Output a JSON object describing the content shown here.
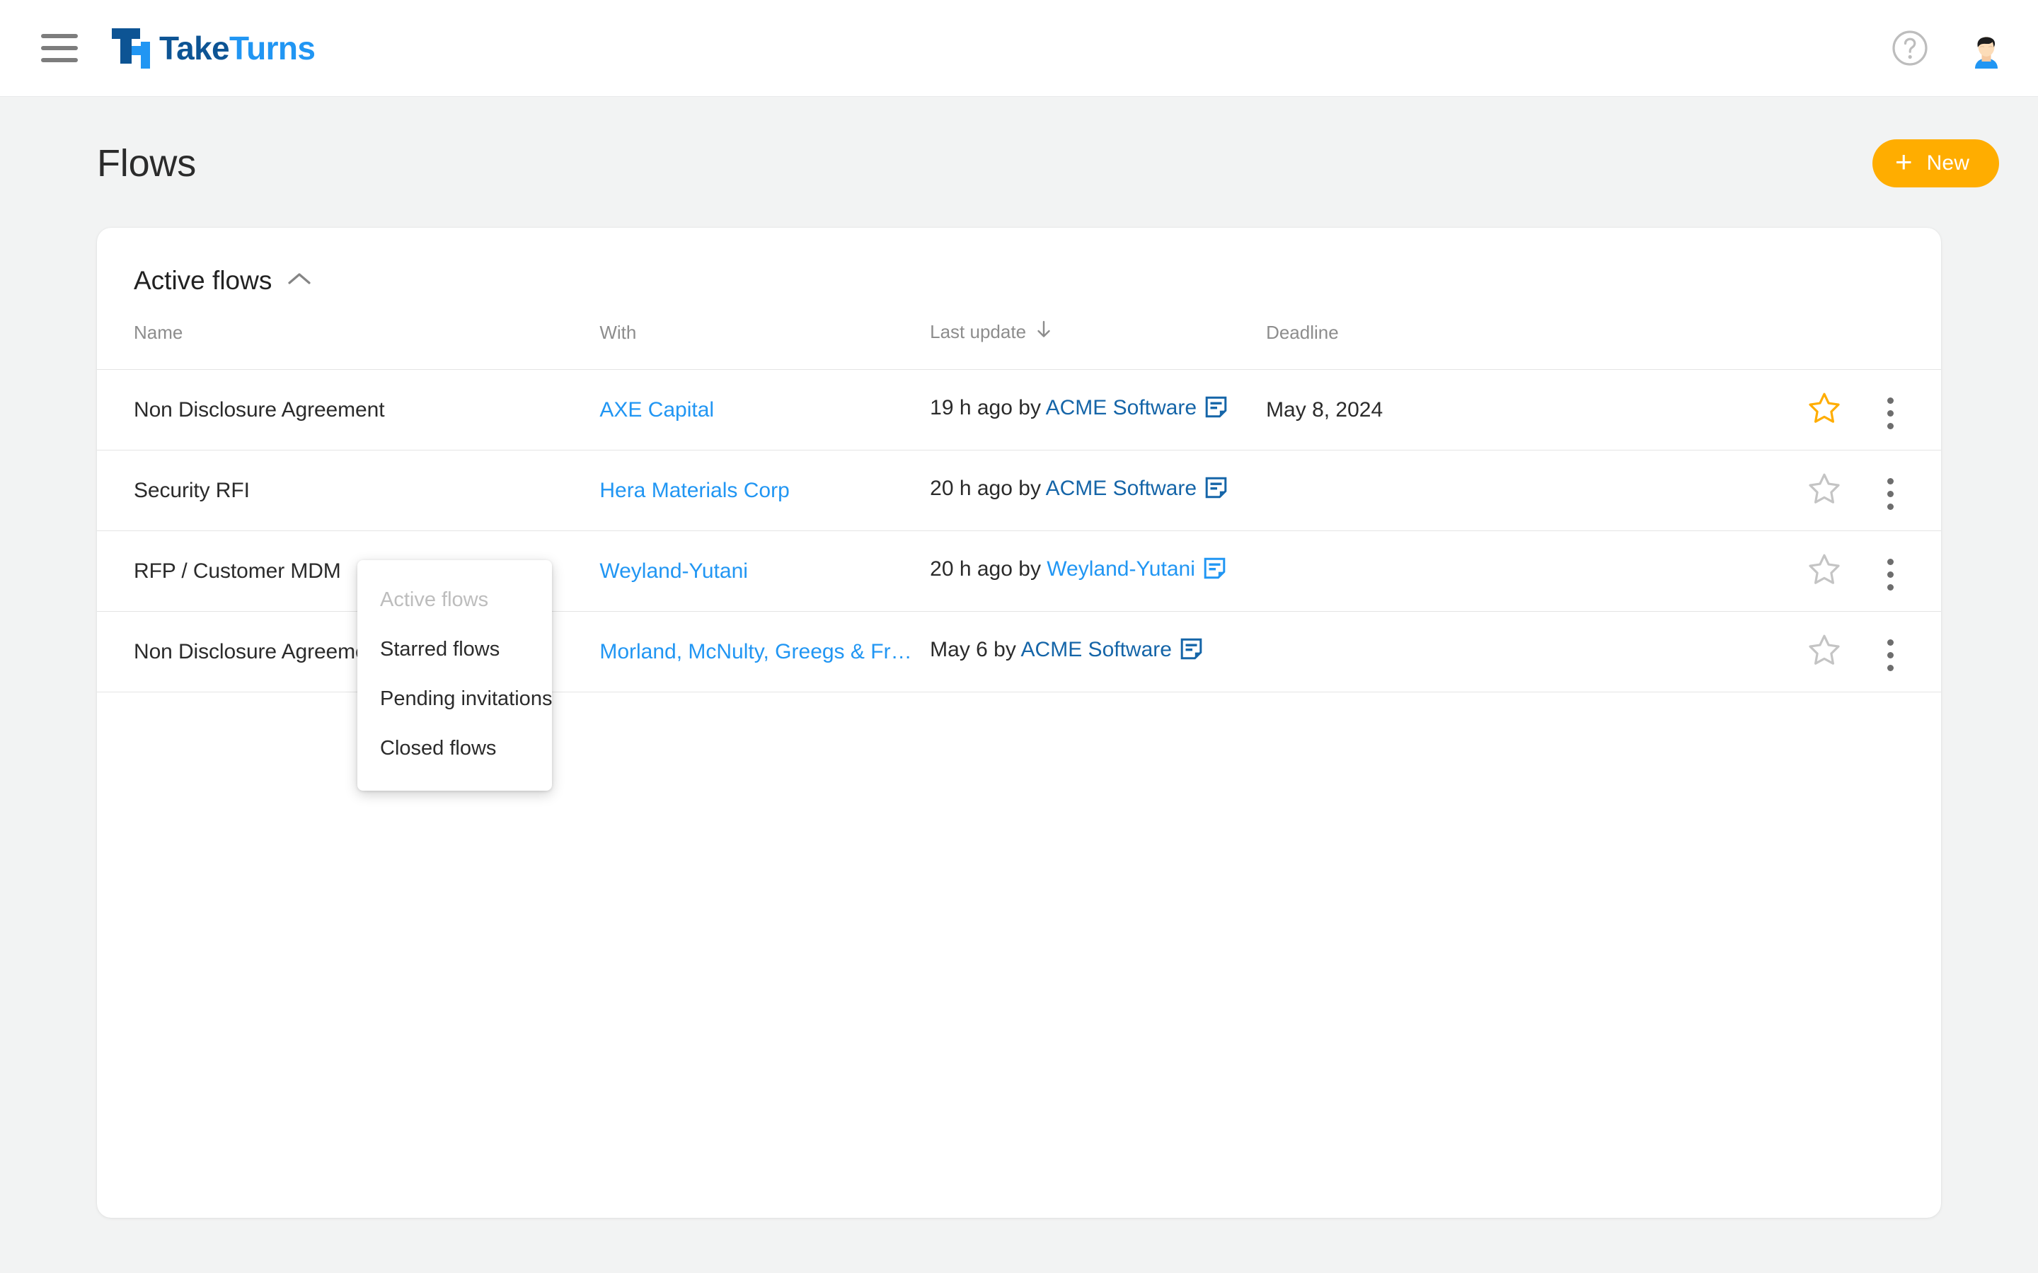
{
  "app": {
    "brand_take": "Take",
    "brand_turns": "Turns",
    "logo_icon": "taketurns-logo-icon",
    "menu_icon": "hamburger-menu-icon",
    "help_icon": "help-circle-icon",
    "avatar_icon": "user-avatar"
  },
  "colors": {
    "brand_dark_blue": "#0d5494",
    "brand_blue": "#2196f3",
    "accent_orange": "#ffad00",
    "star_gold": "#ffad00",
    "muted_text": "#8d8d8d",
    "page_bg": "#f2f3f3",
    "card_bg": "#ffffff",
    "author_dark": "#1565a8"
  },
  "page": {
    "title": "Flows",
    "new_button_label": "New",
    "new_button_icon": "plus-icon"
  },
  "card": {
    "section_label": "Active flows",
    "section_chevron": "chevron-up-icon"
  },
  "dropdown": {
    "open": true,
    "items": [
      {
        "label": "Active flows",
        "selected": true
      },
      {
        "label": "Starred flows",
        "selected": false
      },
      {
        "label": "Pending invitations",
        "selected": false
      },
      {
        "label": "Closed flows",
        "selected": false
      }
    ]
  },
  "table": {
    "columns": [
      {
        "key": "name",
        "label": "Name",
        "sortable": false
      },
      {
        "key": "with",
        "label": "With",
        "sortable": false
      },
      {
        "key": "last_update",
        "label": "Last update",
        "sortable": true,
        "sort_dir": "desc",
        "sort_icon": "arrow-down-icon"
      },
      {
        "key": "deadline",
        "label": "Deadline",
        "sortable": false
      }
    ],
    "rows": [
      {
        "name": "Non Disclosure Agreement",
        "with": "AXE Capital",
        "update_prefix": "19 h ago by",
        "update_author": "ACME Software",
        "author_tone": "dark",
        "doc_icon": "document-icon",
        "deadline": "May 8, 2024",
        "starred": true,
        "star_icon": "star-filled-icon",
        "menu_icon": "kebab-menu-icon"
      },
      {
        "name": "Security RFI",
        "with": "Hera Materials Corp",
        "update_prefix": "20 h ago by",
        "update_author": "ACME Software",
        "author_tone": "dark",
        "doc_icon": "document-icon",
        "deadline": "",
        "starred": false,
        "star_icon": "star-outline-icon",
        "menu_icon": "kebab-menu-icon"
      },
      {
        "name": "RFP / Customer MDM",
        "with": "Weyland-Yutani",
        "update_prefix": "20 h ago by",
        "update_author": "Weyland-Yutani",
        "author_tone": "light",
        "doc_icon": "document-icon",
        "deadline": "",
        "starred": false,
        "star_icon": "star-outline-icon",
        "menu_icon": "kebab-menu-icon"
      },
      {
        "name": "Non Disclosure Agreement",
        "with": "Morland, McNulty, Greegs & Frea...",
        "update_prefix": "May 6 by",
        "update_author": "ACME Software",
        "author_tone": "dark",
        "doc_icon": "document-icon",
        "deadline": "",
        "starred": false,
        "star_icon": "star-outline-icon",
        "menu_icon": "kebab-menu-icon"
      }
    ]
  }
}
